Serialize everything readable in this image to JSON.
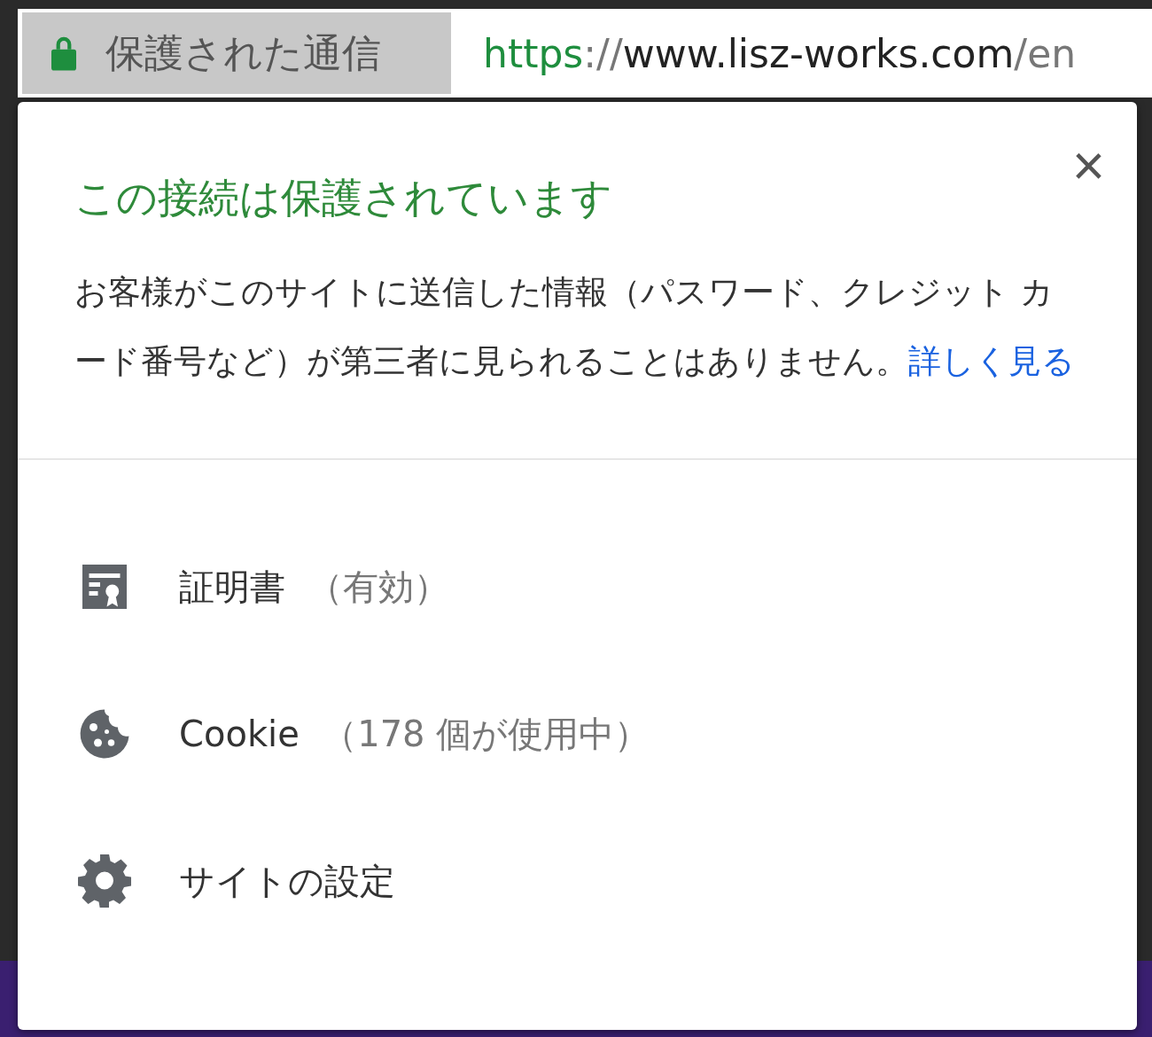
{
  "address_bar": {
    "security_chip": {
      "label": "保護された通信",
      "secure": true
    },
    "url": {
      "scheme": "https",
      "separator": "://",
      "host": "www.lisz-works.com",
      "path": "/en"
    }
  },
  "popup": {
    "title": "この接続は保護されています",
    "close": "×",
    "description": "お客様がこのサイトに送信した情報（パスワード、クレジット カード番号など）が第三者に見られることはありません。",
    "link": "詳しく見る",
    "items": [
      {
        "kind": "certificate",
        "label": "証明書",
        "detail": "（有効）"
      },
      {
        "kind": "cookie",
        "label": "Cookie",
        "detail": "（178 個が使用中）"
      },
      {
        "kind": "settings",
        "label": "サイトの設定"
      }
    ]
  }
}
